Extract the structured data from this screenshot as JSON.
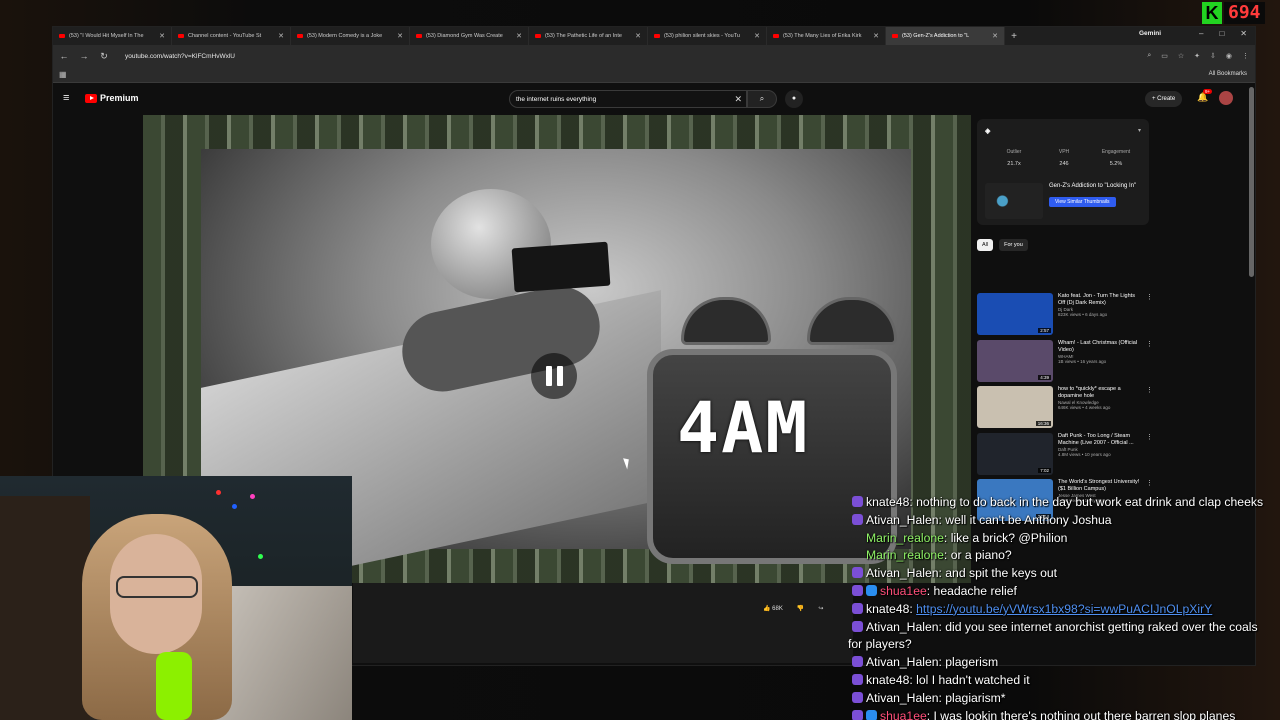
{
  "browser": {
    "tabs": [
      {
        "label": "(53) \"I Would Hit Myself In The",
        "active": false
      },
      {
        "label": "Channel content - YouTube St",
        "active": false
      },
      {
        "label": "(53) Modern Comedy is a Joke",
        "active": false
      },
      {
        "label": "(53) Diamond Gym Was Create",
        "active": false
      },
      {
        "label": "(53) The Pathetic Life of an Inte",
        "active": false
      },
      {
        "label": "(53) philion silent skies - YouTu",
        "active": false
      },
      {
        "label": "(53) The Many Lies of Erika Kirk",
        "active": false
      },
      {
        "label": "(53) Gen-Z's Addiction to \"L",
        "active": true
      }
    ],
    "gemini_label": "Gemini",
    "url": "youtube.com/watch?v=KlFCmHvWxlU",
    "all_bookmarks": "All Bookmarks"
  },
  "youtube": {
    "logo_label": "Premium",
    "search_value": "the internet ruins everything",
    "create_label": "Create",
    "notif_badge": "9+",
    "video_overlay_text": "4AM",
    "likes_count": "68K"
  },
  "extension": {
    "stats": [
      {
        "label": "Outlier",
        "value": "21.7x"
      },
      {
        "label": "VPH",
        "value": "246"
      },
      {
        "label": "Engagement",
        "value": "5.2%"
      }
    ],
    "video_title": "Gen-Z's Addiction to \"Locking In\"",
    "similar_button": "View Similar Thumbnails"
  },
  "chips": [
    {
      "label": "All",
      "selected": true
    },
    {
      "label": "For you",
      "selected": false
    }
  ],
  "recommendations": [
    {
      "title": "Kato feat. Jon - Turn The Lights Off (Dj Dark Remix)",
      "channel": "Dj Dark",
      "stats": "823K views • 6 days ago",
      "duration": "2:57",
      "color": "#1a4db3"
    },
    {
      "title": "Wham! - Last Christmas (Official Video)",
      "channel": "WHAM!",
      "stats": "1B views • 16 years ago",
      "duration": "4:39",
      "color": "#5a4a6a"
    },
    {
      "title": "how to *quickly* escape a dopamine hole",
      "channel": "Nawal el Knowledge",
      "stats": "646K views • 4 weeks ago",
      "duration": "16:36",
      "color": "#c9c0b0"
    },
    {
      "title": "Daft Punk - Too Long / Steam Machine (Live 2007 - Official ...",
      "channel": "Daft Punk",
      "stats": "4.8M views • 10 years ago",
      "duration": "7:02",
      "color": "#20242c"
    },
    {
      "title": "The World's Strongest University! ($1 Billion Campus)",
      "channel": "Jesse James West",
      "stats": "1.1M views • 1 day ago",
      "duration": "27:14",
      "color": "#3a78c0"
    }
  ],
  "chat": [
    {
      "user": "knate48",
      "color": "#ffffff",
      "text": ": nothing to do back in the day but work eat drink and clap cheeks",
      "icon": "purple"
    },
    {
      "user": "Ativan_Halen",
      "color": "#ffffff",
      "text": ": well it can't be Anthony Joshua",
      "icon": "purple"
    },
    {
      "user": "Marin_realone",
      "color": "#8ff266",
      "text": ": like a brick? @Philion",
      "icon": "none"
    },
    {
      "user": "Marin_realone",
      "color": "#8ff266",
      "text": ": or a piano?",
      "icon": "none"
    },
    {
      "user": "Ativan_Halen",
      "color": "#ffffff",
      "text": ": and spit the keys out",
      "icon": "purple"
    },
    {
      "user": "shua1ee",
      "color": "#ff4f7a",
      "text": ": headache relief",
      "icon": "both"
    },
    {
      "user": "knate48",
      "color": "#ffffff",
      "text": ": ",
      "link": "https://youtu.be/yVWrsx1bx98?si=wwPuACIJnOLpXirY",
      "icon": "purple"
    },
    {
      "user": "Ativan_Halen",
      "color": "#ffffff",
      "text": ": did you see internet anorchist getting raked over the coals for players?",
      "icon": "purple"
    },
    {
      "user": "Ativan_Halen",
      "color": "#ffffff",
      "text": ": plagerism",
      "icon": "purple"
    },
    {
      "user": "knate48",
      "color": "#ffffff",
      "text": ": lol I hadn't watched it",
      "icon": "purple"
    },
    {
      "user": "Ativan_Halen",
      "color": "#ffffff",
      "text": ": plagiarism*",
      "icon": "purple"
    },
    {
      "user": "shua1ee",
      "color": "#ff4f7a",
      "text": ": I was lookin there's nothing out there barren slop planes",
      "icon": "both"
    }
  ],
  "kick": {
    "logo": "K",
    "count": "694"
  }
}
